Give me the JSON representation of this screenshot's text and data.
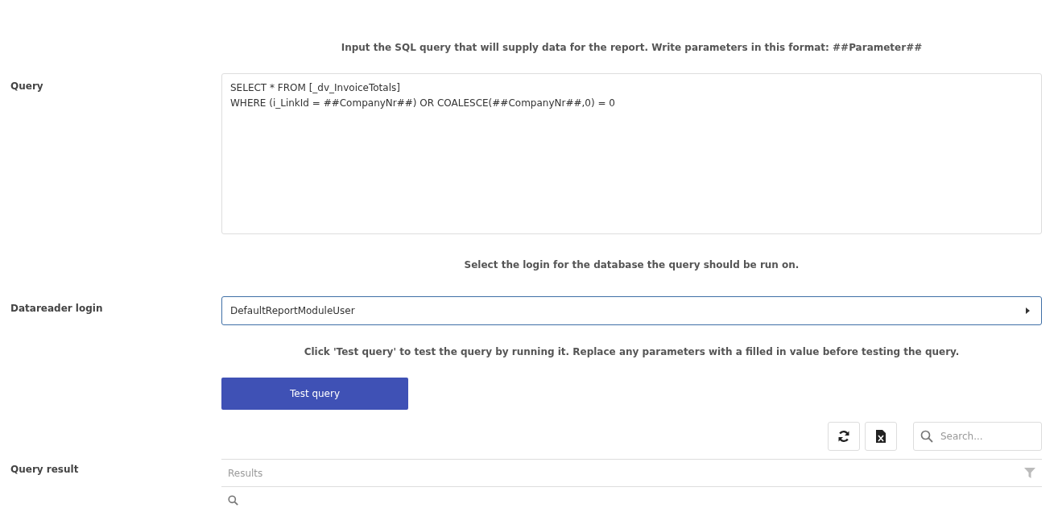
{
  "query_hint": "Input the SQL query that will supply data for the report. Write parameters in this format: ##Parameter##",
  "query": {
    "label": "Query",
    "value": "SELECT * FROM [_dv_InvoiceTotals]\nWHERE (i_LinkId = ##CompanyNr##) OR COALESCE(##CompanyNr##,0) = 0"
  },
  "login_hint": "Select the login for the database the query should be run on.",
  "login": {
    "label": "Datareader login",
    "value": "DefaultReportModuleUser"
  },
  "test_hint": "Click 'Test query' to test the query by running it. Replace any parameters with a filled in value before testing the query.",
  "test_button": "Test query",
  "result": {
    "label": "Query result",
    "search_placeholder": "Search...",
    "column_header": "Results"
  }
}
